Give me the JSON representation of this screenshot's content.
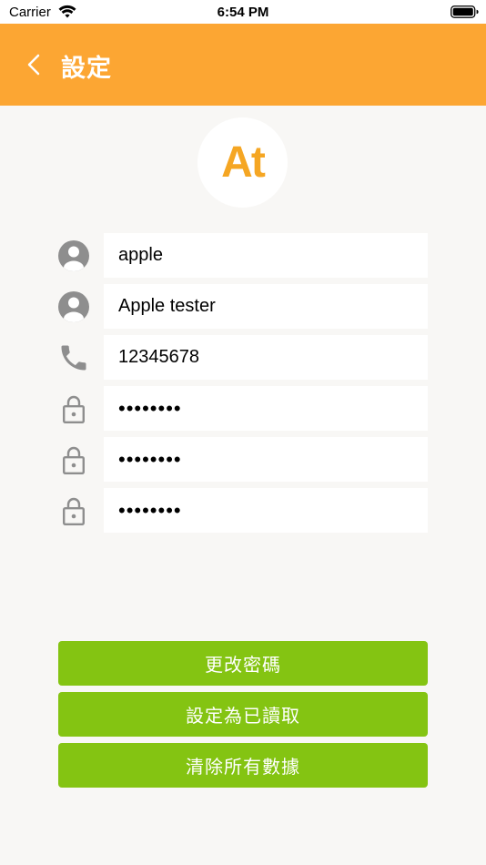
{
  "status_bar": {
    "carrier": "Carrier",
    "time": "6:54 PM"
  },
  "nav": {
    "title": "設定",
    "back_icon": "chevron-left-icon"
  },
  "avatar": {
    "text": "At"
  },
  "fields": [
    {
      "icon": "person-icon",
      "value": "apple"
    },
    {
      "icon": "person-icon",
      "value": "Apple tester"
    },
    {
      "icon": "phone-icon",
      "value": "12345678"
    },
    {
      "icon": "lock-icon",
      "value": "••••••••"
    },
    {
      "icon": "lock-icon",
      "value": "••••••••"
    },
    {
      "icon": "lock-icon",
      "value": "••••••••"
    }
  ],
  "buttons": {
    "change_password": "更改密碼",
    "mark_read": "設定為已讀取",
    "clear_data": "清除所有數據"
  },
  "colors": {
    "header": "#fca633",
    "accent": "#f5a623",
    "button": "#84c412",
    "icon": "#8e8e8e",
    "background": "#f8f7f5"
  }
}
